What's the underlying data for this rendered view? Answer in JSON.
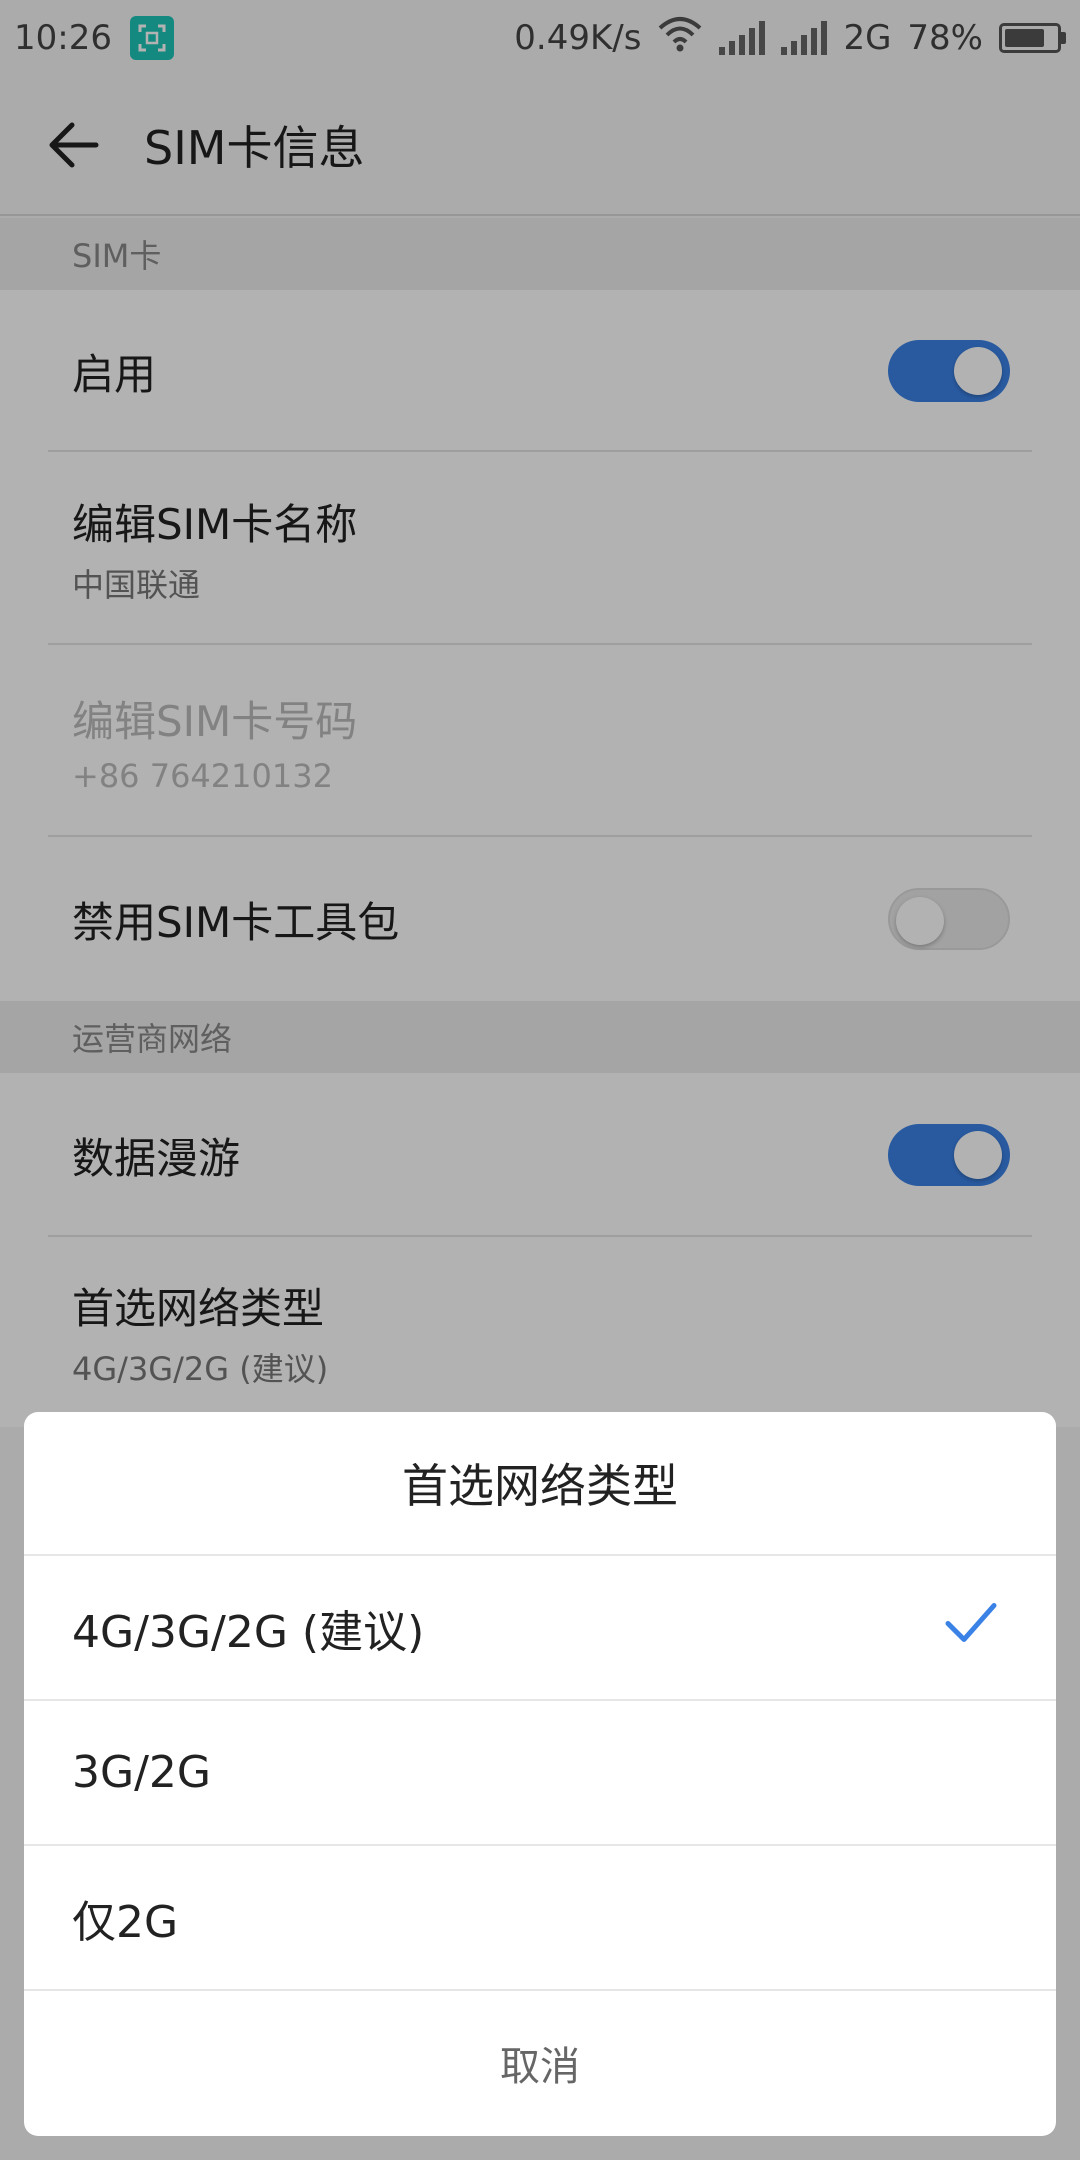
{
  "status_bar": {
    "time": "10:26",
    "speed": "0.49K/s",
    "network": "2G",
    "battery": "78%",
    "battery_level": 0.78
  },
  "header": {
    "title": "SIM卡信息"
  },
  "sections": {
    "sim": {
      "label": "SIM卡",
      "enable": {
        "title": "启用",
        "on": true
      },
      "edit_name": {
        "title": "编辑SIM卡名称",
        "subtitle": "中国联通"
      },
      "edit_number": {
        "title": "编辑SIM卡号码",
        "subtitle": "+86 764210132"
      },
      "toolkit": {
        "title": "禁用SIM卡工具包",
        "on": false
      }
    },
    "carrier": {
      "label": "运营商网络",
      "roaming": {
        "title": "数据漫游",
        "on": true
      },
      "network_type": {
        "title": "首选网络类型",
        "subtitle": "4G/3G/2G (建议)"
      }
    }
  },
  "dialog": {
    "title": "首选网络类型",
    "options": [
      {
        "label": "4G/3G/2G (建议)",
        "selected": true
      },
      {
        "label": "3G/2G",
        "selected": false
      },
      {
        "label": "仅2G",
        "selected": false
      }
    ],
    "cancel": "取消"
  },
  "colors": {
    "accent": "#3b82e6",
    "check": "#3b82e6"
  },
  "icons": {
    "back": "arrow-left-icon",
    "check": "checkmark-icon",
    "wifi": "wifi-icon",
    "signal": "signal-icon",
    "battery": "battery-icon"
  }
}
